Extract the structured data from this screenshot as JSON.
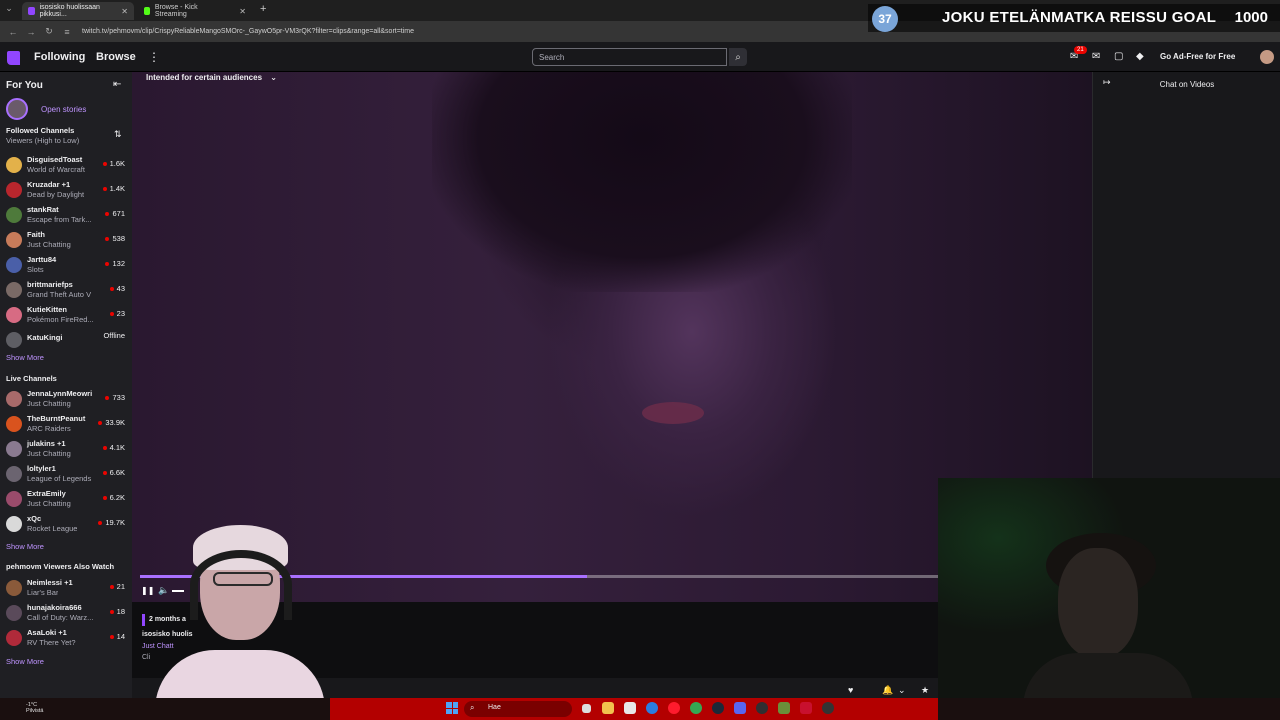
{
  "browser": {
    "tabs": [
      {
        "label": "isosisko huolissaan pikkusi...",
        "active": true,
        "favicon_color": "#9146ff"
      },
      {
        "label": "Browse - Kick Streaming",
        "active": false,
        "favicon_color": "#53fc18"
      }
    ],
    "url": "twitch.tv/pehmovm/clip/CrispyReliableMangoSMOrc-_GaywO5pr-VM3rQK?filter=clips&range=all&sort=time",
    "new_tab": "+",
    "nav_back": "←",
    "nav_forward": "→",
    "nav_reload": "↻",
    "menu_chevron": "⌄"
  },
  "overlay_goal": {
    "current": "37",
    "title": "JOKU ETELÄNMATKA REISSU GOAL",
    "target": "1000"
  },
  "topnav": {
    "following": "Following",
    "browse": "Browse",
    "more": "⋮",
    "search_placeholder": "Search",
    "search_icon": "⌕",
    "notification_count": "21",
    "ad_free": "Go Ad-Free for Free",
    "brand_color": "#9146ff"
  },
  "sidebar": {
    "title": "For You",
    "collapse_icon": "⇤",
    "open_stories": "Open stories",
    "followed": {
      "title": "Followed Channels",
      "sort": "Viewers (High to Low)",
      "sort_icon": "⇅",
      "channels": [
        {
          "name": "DisguisedToast",
          "game": "World of Warcraft",
          "viewers": "1.6K",
          "live": true,
          "color": "#e3b14a"
        },
        {
          "name": "Kruzadar +1",
          "game": "Dead by Daylight",
          "viewers": "1.4K",
          "live": true,
          "color": "#b8262d"
        },
        {
          "name": "stankRat",
          "game": "Escape from Tark...",
          "viewers": "671",
          "live": true,
          "color": "#4e7a3b"
        },
        {
          "name": "Faith",
          "game": "Just Chatting",
          "viewers": "538",
          "live": true,
          "color": "#c77b5a"
        },
        {
          "name": "Jarttu84",
          "game": "Slots",
          "viewers": "132",
          "live": true,
          "color": "#4a5fa8"
        },
        {
          "name": "brittmariefps",
          "game": "Grand Theft Auto V",
          "viewers": "43",
          "live": true,
          "color": "#7a6a66"
        },
        {
          "name": "KutieKitten",
          "game": "Pokémon FireRed...",
          "viewers": "23",
          "live": true,
          "color": "#d76b83"
        },
        {
          "name": "KatuKingi",
          "game": "",
          "viewers": "Offline",
          "live": false,
          "color": "#5e5e64"
        }
      ],
      "show_more": "Show More"
    },
    "live": {
      "title": "Live Channels",
      "channels": [
        {
          "name": "JennaLynnMeowri",
          "game": "Just Chatting",
          "viewers": "733",
          "live": true,
          "color": "#a86a6a"
        },
        {
          "name": "TheBurntPeanut",
          "game": "ARC Raiders",
          "viewers": "33.9K",
          "live": true,
          "color": "#d9531e"
        },
        {
          "name": "julakins +1",
          "game": "Just Chatting",
          "viewers": "4.1K",
          "live": true,
          "color": "#8a7a90"
        },
        {
          "name": "loltyler1",
          "game": "League of Legends",
          "viewers": "6.6K",
          "live": true,
          "color": "#6b6470"
        },
        {
          "name": "ExtraEmily",
          "game": "Just Chatting",
          "viewers": "6.2K",
          "live": true,
          "color": "#9a4b6b"
        },
        {
          "name": "xQc",
          "game": "Rocket League",
          "viewers": "19.7K",
          "live": true,
          "color": "#d9d9d9"
        }
      ],
      "show_more": "Show More"
    },
    "also_watch": {
      "title": "pehmovm Viewers Also Watch",
      "channels": [
        {
          "name": "Neimlessi +1",
          "game": "Liar's Bar",
          "viewers": "21",
          "live": true,
          "color": "#8a5a3a"
        },
        {
          "name": "hunajakoira666",
          "game": "Call of Duty: Warz...",
          "viewers": "18",
          "live": true,
          "color": "#5a4a5a"
        },
        {
          "name": "AsaLoki +1",
          "game": "RV There Yet?",
          "viewers": "14",
          "live": true,
          "color": "#b02a3a"
        }
      ],
      "show_more": "Show More"
    }
  },
  "player": {
    "audience_label": "Intended for certain audiences",
    "audience_chevron": "⌄",
    "progress": 0.56,
    "pause_icon": "❚❚",
    "volume_icon": "🔈"
  },
  "clip_info": {
    "date": "2 months a",
    "title": "isosisko huolis",
    "category": "Just Chatt",
    "clipped_by": "Cli"
  },
  "chat": {
    "collapse_icon": "↦",
    "title": "Chat on Videos"
  },
  "taskbar": {
    "weather_temp": "-1°C",
    "weather_text": "Pilvistä",
    "search": "Hae",
    "accent": "#b30000"
  }
}
